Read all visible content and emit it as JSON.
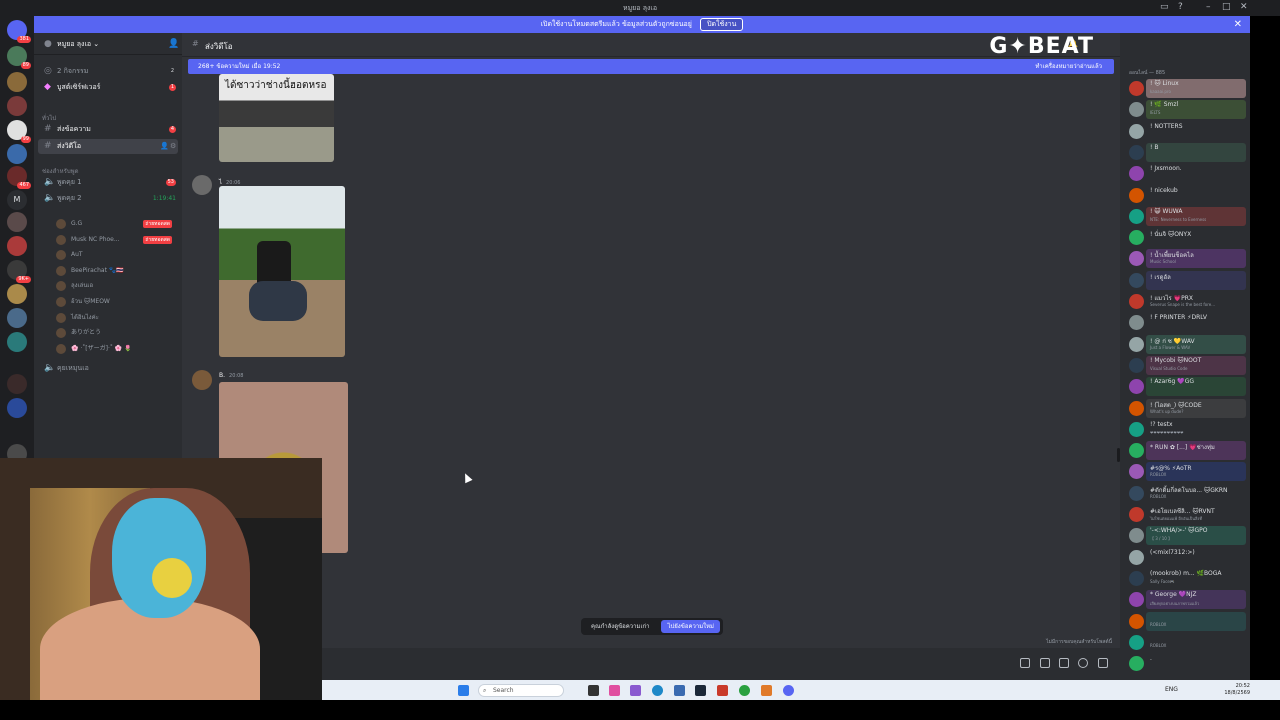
{
  "window": {
    "title": "หมูยอ ลุงเอ"
  },
  "banner": {
    "text": "เปิดใช้งานโหมดสตรีมแล้ว ข้อมูลส่วนตัวถูกซ่อนอยู่",
    "button": "ปิดใช้งาน"
  },
  "overlay_logo": "G✦BEAT",
  "server_badges": [
    "381",
    "89",
    "99",
    "467",
    "9K+"
  ],
  "sidebar": {
    "server_name": "หมูยอ ลุงเอ ⌄",
    "activities": {
      "label": "2 กิจกรรม",
      "count": "2"
    },
    "boost": {
      "label": "บูสต์เซิร์ฟเวอร์",
      "count": "1"
    },
    "cat_general": "ทั่วไป",
    "text_channels": [
      {
        "name": "ส่งข้อความ",
        "badge": "4"
      },
      {
        "name": "ส่งวิดีโอ",
        "badge": ""
      }
    ],
    "cat_voice": "ช่องสำหรับพูด",
    "voice_channels": [
      {
        "name": "พูดคุย 1",
        "badge": "53"
      },
      {
        "name": "พูดคุย 2",
        "timer": "1:19:41"
      }
    ],
    "voice_users": [
      {
        "name": "G.G",
        "live": "ถ่ายทอดสด"
      },
      {
        "name": "Musk NC Phoe...",
        "live": "ถ่ายทอดสด"
      },
      {
        "name": "AuT",
        "live": ""
      },
      {
        "name": "BeePirachat 🐾🇹🇭",
        "live": ""
      },
      {
        "name": "ลุงเล่นเอ",
        "live": ""
      },
      {
        "name": "อ้วน 🐱MEOW",
        "live": ""
      },
      {
        "name": "ได้อินไงค่ะ",
        "live": ""
      },
      {
        "name": "ありがとう",
        "live": ""
      },
      {
        "name": "🌸 ·˚[ザーガ]·˚ 🌸 🌷",
        "live": ""
      }
    ],
    "extra_channel": "คุยเหมุนเอ"
  },
  "channel_header": {
    "name": "ส่งวิดีโอ"
  },
  "new_messages_bar": {
    "left": "268+ ข้อความใหม่ เมื่อ 19:52",
    "right": "ทำเครื่องหมายว่าอ่านแล้ว"
  },
  "messages": [
    {
      "image_caption": "ได้ซาวว่าช่างนี้ฮอตหรอ"
    },
    {
      "author": "ไ",
      "time": "20:06"
    },
    {
      "author": "B.",
      "time": "20:08"
    }
  ],
  "jump_bar": {
    "text": "คุณกำลังดูข้อความเก่า",
    "button": "ไปยังข้อความใหม่"
  },
  "composer_note": "ไม่มีการขอบคุณสำหรับโพสต์นี้",
  "members": {
    "header": "ออนไลน์ — 885",
    "list": [
      {
        "name": "! 🐱 Linux",
        "activity": "kaaaai.pro",
        "color": "#c9a0a0"
      },
      {
        "name": "! 🌿 Smzl",
        "activity": "IELTS",
        "color": "#4a6b3a"
      },
      {
        "name": "! NOTTERS",
        "activity": "",
        "color": ""
      },
      {
        "name": "! B",
        "activity": "",
        "color": "#3a5a4a"
      },
      {
        "name": "! Jxsmoon.",
        "activity": "",
        "color": ""
      },
      {
        "name": "! nicekub",
        "activity": "",
        "color": ""
      },
      {
        "name": "! 😺 WUWA",
        "activity": "NTE: Neverness to Everness",
        "color": "#8a3a3a"
      },
      {
        "name": "! นั่นจิ 🐱ONYX",
        "activity": "",
        "color": ""
      },
      {
        "name": "! น้ำเพี้ยนช็อคไล",
        "activity": "Music School",
        "color": "#6a3a8a"
      },
      {
        "name": "! เรดูอัล",
        "activity": "",
        "color": "#3a3a6a"
      },
      {
        "name": "! แมวไร 💗PRX",
        "activity": "Severus Snape is the best fore...",
        "color": ""
      },
      {
        "name": "! F PRINTER ⚡DRLV",
        "activity": "",
        "color": ""
      },
      {
        "name": "! @ ก่ ซ 💛WAV",
        "activity": "Just a Flower & WAV",
        "color": "#3a6a5a"
      },
      {
        "name": "! Mycobi 🐱NOOT",
        "activity": "Visual Studio Code",
        "color": "#6a3a5a"
      },
      {
        "name": "! Azar6g 💜GG",
        "activity": "",
        "color": "#2a5a3a"
      },
      {
        "name": "! (ไอสต_) 🐱CODE",
        "activity": "What's up dude?",
        "color": "#4a4a4a"
      },
      {
        "name": "!? testx",
        "activity": "❤❤❤❤❤❤❤❤❤❤",
        "color": ""
      },
      {
        "name": "* RUN ✿ [...] 💗ช่างทุ่ม",
        "activity": "",
        "color": "#6a3a7a"
      },
      {
        "name": "#ร@% ⚡AoTR",
        "activity": "ROBLOX",
        "color": "#2a3a7a"
      },
      {
        "name": "#ดักดิ้มกี่ลดโนบอ... 🐱GKRN",
        "activity": "ROBLOX",
        "color": ""
      },
      {
        "name": "#เอโยเบลซีลิ... 🐱RVNT",
        "activity": "ไม่ใช่แต่ยอมแพ้ อีกอันเป็นสิ่งที่",
        "color": ""
      },
      {
        "name": "'-<:WHA/>-' 🐱GPO",
        "activity": "【 3 / 10 】",
        "color": "#2a6a5a"
      },
      {
        "name": "(<mixl7312:>)",
        "activity": "",
        "color": ""
      },
      {
        "name": "(mookrob) m... 🌿BOGA",
        "activity": "Sally Face🎮",
        "color": ""
      },
      {
        "name": "* George 💜NJZ",
        "activity": "เสียงทุกอย่างบนภาพรวมแล้ว",
        "color": "#5a3a7a"
      },
      {
        "name": "",
        "activity": "ROBLOX",
        "color": "#2a5a5a"
      },
      {
        "name": "",
        "activity": "ROBLOX",
        "color": ""
      },
      {
        "name": ".",
        "activity": "",
        "color": ""
      }
    ]
  },
  "taskbar": {
    "search": "Search",
    "lang": "ENG",
    "time": "20:52",
    "date": "18/8/2569"
  }
}
